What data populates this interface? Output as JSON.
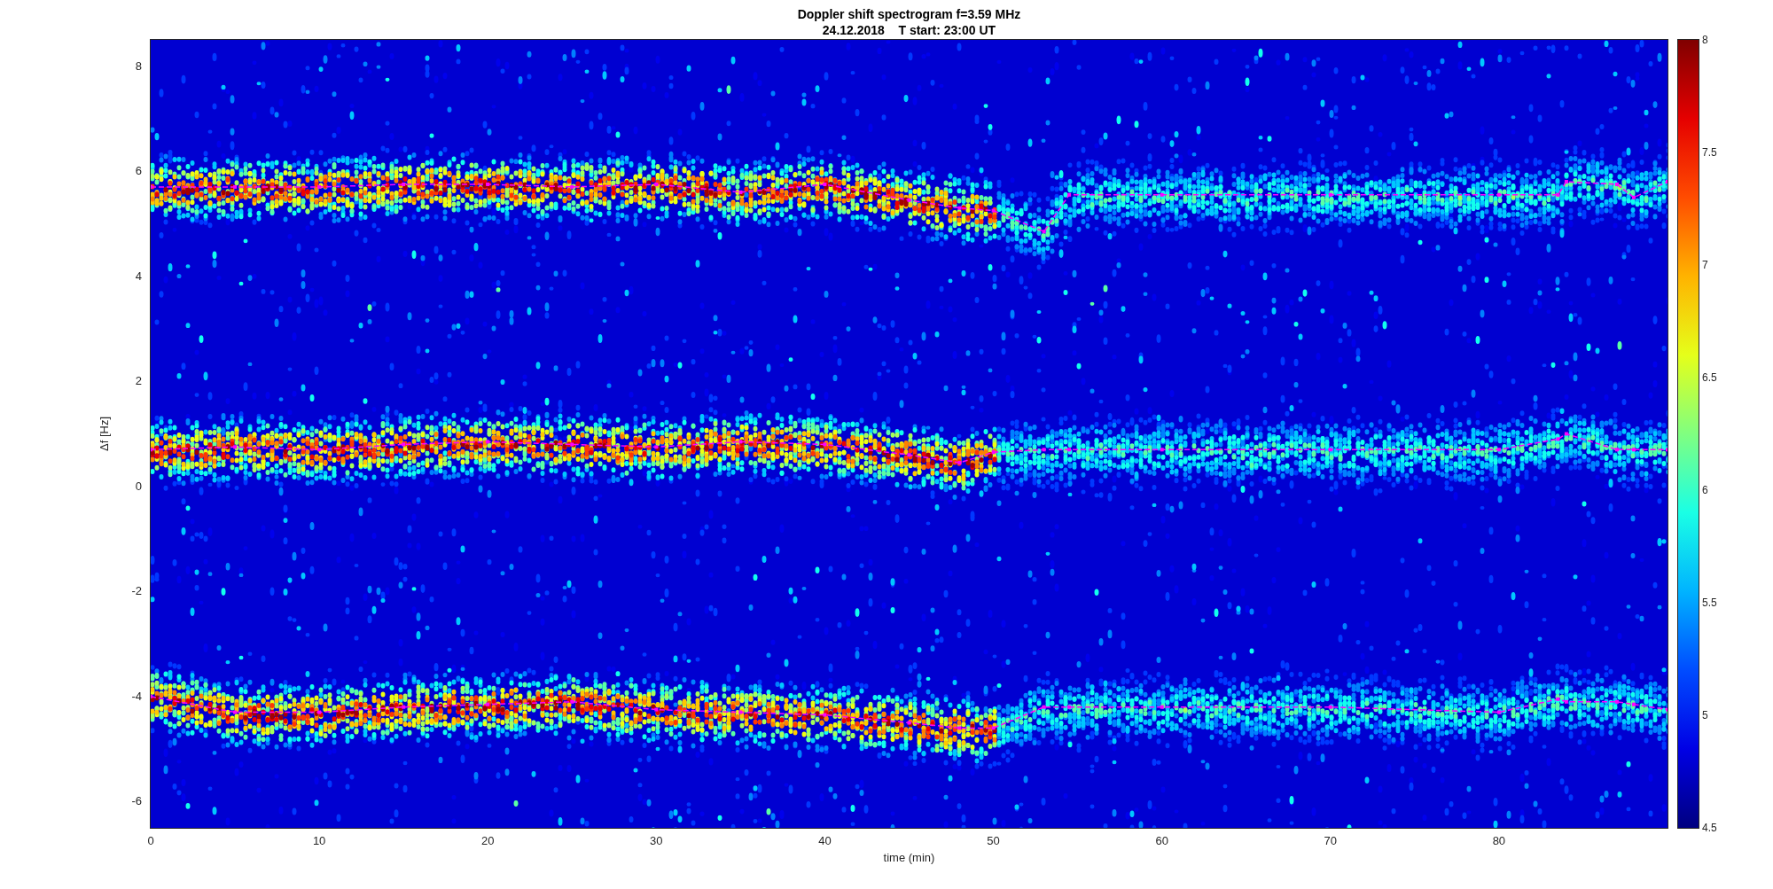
{
  "figure": {
    "title": "Doppler shift spectrogram f=3.59 MHz",
    "subtitle": "24.12.2018    T start: 23:00 UT",
    "chart_data": {
      "type": "line",
      "xlabel": "time (min)",
      "ylabel": "Δf [Hz]",
      "xlim": [
        0,
        90
      ],
      "ylim": [
        -6.5,
        8.5
      ],
      "xticks": [
        {
          "value": 0,
          "label": "0"
        },
        {
          "value": 10,
          "label": "10"
        },
        {
          "value": 20,
          "label": "20"
        },
        {
          "value": 30,
          "label": "30"
        },
        {
          "value": 40,
          "label": "40"
        },
        {
          "value": 50,
          "label": "50"
        },
        {
          "value": 60,
          "label": "60"
        },
        {
          "value": 70,
          "label": "70"
        },
        {
          "value": 80,
          "label": "80"
        }
      ],
      "yticks": [
        {
          "value": -6,
          "label": "-6"
        },
        {
          "value": -4,
          "label": "-4"
        },
        {
          "value": -2,
          "label": "-2"
        },
        {
          "value": 0,
          "label": "0"
        },
        {
          "value": 2,
          "label": "2"
        },
        {
          "value": 4,
          "label": "4"
        },
        {
          "value": 6,
          "label": "6"
        },
        {
          "value": 8,
          "label": "8"
        }
      ],
      "x": [
        0,
        5,
        10,
        15,
        20,
        25,
        30,
        35,
        40,
        45,
        48,
        50,
        53,
        54.5,
        60,
        70,
        80,
        83.5,
        84,
        87,
        88,
        90
      ],
      "series": [
        {
          "color": "#ff00ff",
          "line_style": "dashed",
          "marker": "square",
          "values": [
            5.7,
            5.7,
            5.7,
            5.75,
            5.75,
            5.7,
            5.75,
            5.6,
            5.75,
            5.45,
            5.3,
            5.25,
            4.85,
            5.55,
            5.55,
            5.55,
            5.55,
            5.55,
            5.8,
            5.75,
            5.5,
            5.8
          ]
        },
        {
          "color": "#ff00ff",
          "line_style": "dashed",
          "marker": "square",
          "values": [
            0.7,
            0.75,
            0.7,
            0.8,
            0.85,
            0.8,
            0.75,
            0.85,
            0.8,
            0.6,
            0.45,
            0.65,
            0.7,
            0.7,
            0.7,
            0.7,
            0.7,
            0.9,
            1.0,
            0.7,
            0.7,
            0.7
          ]
        },
        {
          "color": "#ff00ff",
          "line_style": "dashed",
          "marker": "square",
          "values": [
            -4.0,
            -4.3,
            -4.3,
            -4.2,
            -4.15,
            -4.1,
            -4.25,
            -4.3,
            -4.35,
            -4.5,
            -4.6,
            -4.6,
            -4.2,
            -4.2,
            -4.2,
            -4.2,
            -4.3,
            -4.05,
            -4.1,
            -4.1,
            -4.15,
            -4.25
          ]
        }
      ]
    },
    "colorbar": {
      "ticks": [
        "8",
        "7.5",
        "7",
        "6.5",
        "6",
        "5.5",
        "5",
        "4.5"
      ]
    }
  }
}
